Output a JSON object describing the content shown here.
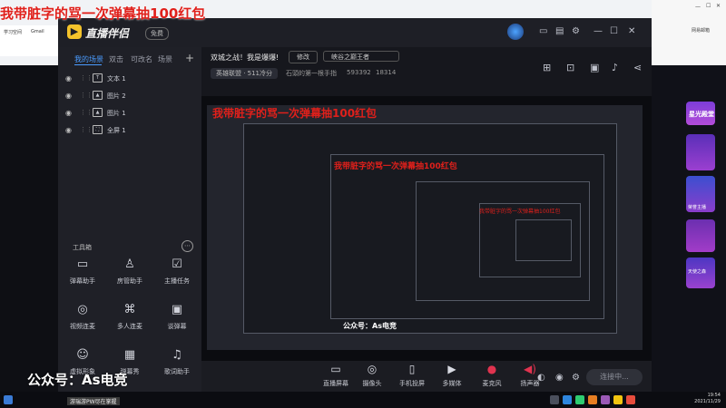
{
  "banner_text": "我带脏字的骂一次弹幕抽100红包",
  "app": {
    "name": "直播伴侣",
    "beta_label": "免费",
    "live_title": "双城之战！我是爆爆!",
    "edit_label": "修改",
    "category": "峡谷之巅王者",
    "room_type": "英雄联盟 · 511冷分",
    "room_name": "石頭的第一根手指",
    "room_id": "593392",
    "fans": "18314"
  },
  "scene_tabs": [
    "我的场景",
    "双击",
    "可改名",
    "场景"
  ],
  "sources": [
    {
      "label": "文本 1",
      "icon": "text-icon"
    },
    {
      "label": "图片 2",
      "icon": "image-icon"
    },
    {
      "label": "图片 1",
      "icon": "image-icon"
    },
    {
      "label": "全屏 1",
      "icon": "fullscreen-icon"
    }
  ],
  "toolbox": {
    "title": "工具箱",
    "tools": [
      {
        "label": "弹幕助手",
        "icon": "danmaku-icon"
      },
      {
        "label": "房管助手",
        "icon": "admin-icon"
      },
      {
        "label": "主播任务",
        "icon": "task-icon"
      },
      {
        "label": "视频连麦",
        "icon": "video-link-icon"
      },
      {
        "label": "多人连麦",
        "icon": "multi-link-icon"
      },
      {
        "label": "谈弹幕",
        "icon": "chat-icon"
      },
      {
        "label": "虚拟形象",
        "icon": "avatar-icon"
      },
      {
        "label": "弹幕秀",
        "icon": "show-icon"
      },
      {
        "label": "歌词助手",
        "icon": "lyrics-icon"
      }
    ]
  },
  "bottom_bar": {
    "buttons": [
      {
        "label": "直播屏幕",
        "icon": "screen-icon"
      },
      {
        "label": "摄像头",
        "icon": "camera-icon"
      },
      {
        "label": "手机投屏",
        "icon": "phone-icon"
      },
      {
        "label": "多媒体",
        "icon": "media-icon"
      },
      {
        "label": "麦克风",
        "icon": "mic-icon"
      },
      {
        "label": "扬声器",
        "icon": "speaker-icon"
      }
    ],
    "connect_label": "连接中..."
  },
  "watermark": {
    "main": "公众号：As电竞",
    "sub": "游瑞游PW尽在掌握"
  },
  "promo": {
    "title": "星光殿堂",
    "item1": "荣誉主播",
    "item2": "天使之森"
  },
  "browser": {
    "tab1": "学习空间",
    "tab2": "Gmail",
    "tab3": "网易邮箱"
  },
  "taskbar": {
    "time": "19:54",
    "date": "2021/11/29"
  },
  "colors": {
    "banner": "#e0201b",
    "accent": "#4a9cff",
    "alert": "#e0334f",
    "logo": "#f4c32b"
  }
}
